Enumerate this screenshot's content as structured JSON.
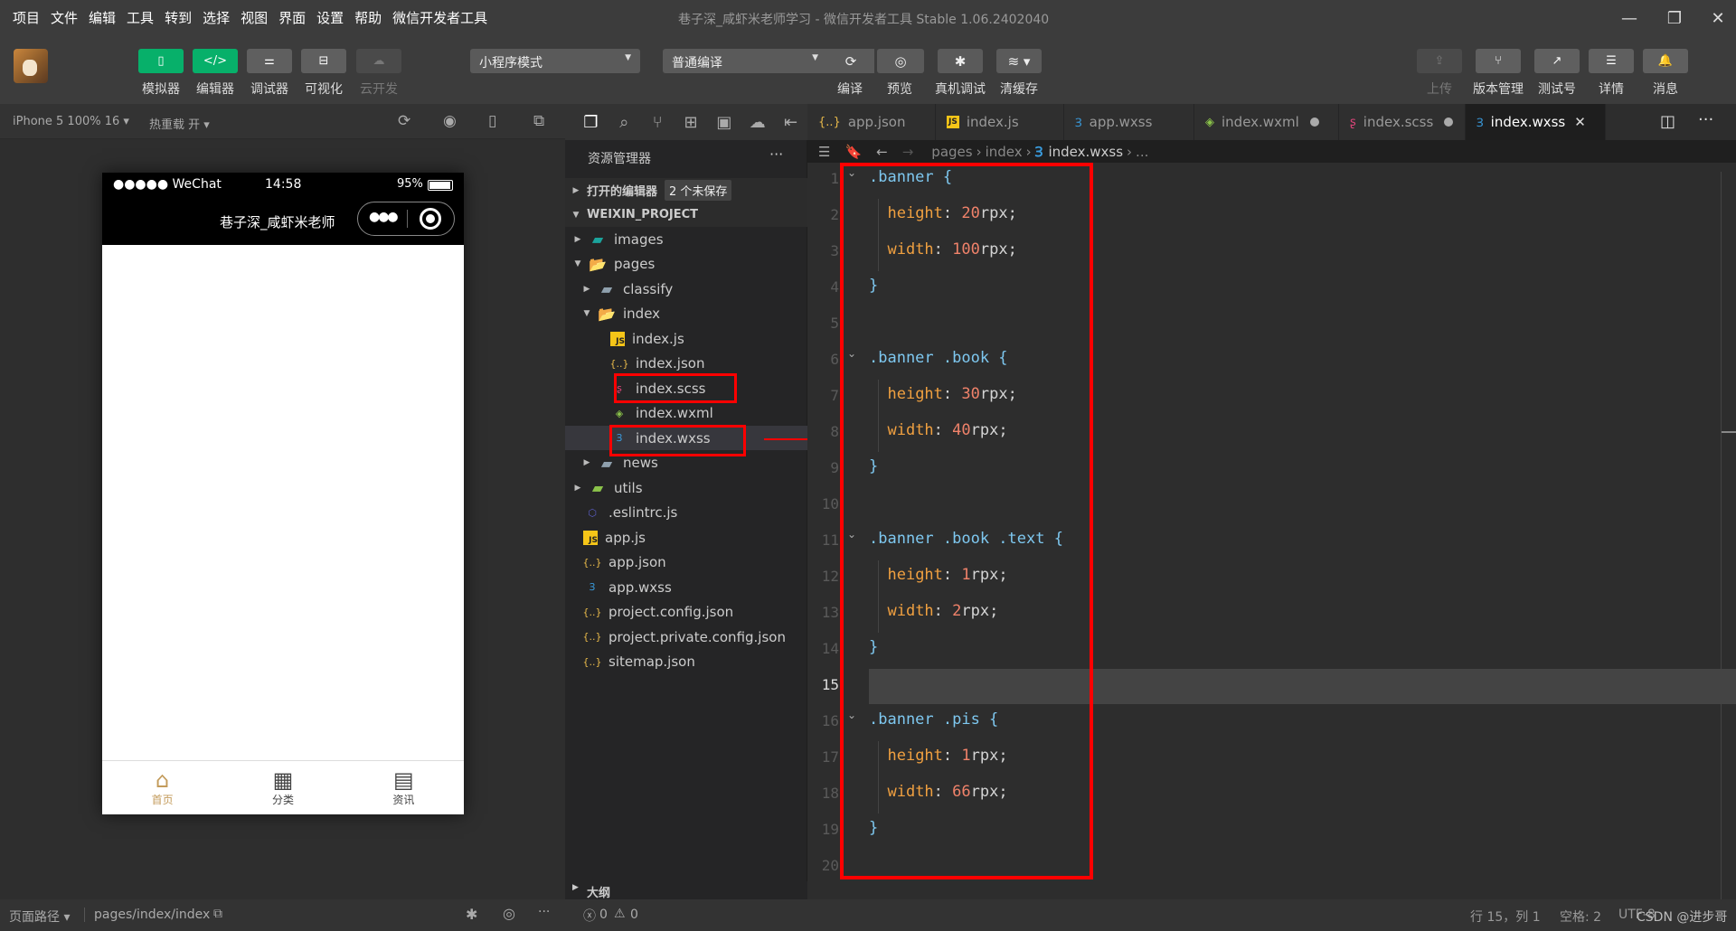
{
  "menu": [
    "项目",
    "文件",
    "编辑",
    "工具",
    "转到",
    "选择",
    "视图",
    "界面",
    "设置",
    "帮助",
    "微信开发者工具"
  ],
  "window_title": "巷子深_咸虾米老师学习 - 微信开发者工具 Stable 1.06.2402040",
  "toolbar": {
    "left_buttons": [
      {
        "label": "模拟器",
        "icon": "phone-icon",
        "state": "active"
      },
      {
        "label": "编辑器",
        "icon": "code-icon",
        "state": "active"
      },
      {
        "label": "调试器",
        "icon": "sliders-icon",
        "state": "normal"
      },
      {
        "label": "可视化",
        "icon": "layout-icon",
        "state": "normal"
      },
      {
        "label": "云开发",
        "icon": "cloud-icon",
        "state": "disabled"
      }
    ],
    "mode_select": "小程序模式",
    "compile_select": "普通编译",
    "mid_buttons": [
      {
        "label": "编译",
        "icon": "refresh-icon"
      },
      {
        "label": "预览",
        "icon": "eye-icon"
      },
      {
        "label": "真机调试",
        "icon": "bug-icon"
      },
      {
        "label": "清缓存",
        "icon": "layers-icon"
      }
    ],
    "right_buttons": [
      {
        "label": "上传",
        "icon": "upload-icon",
        "state": "disabled"
      },
      {
        "label": "版本管理",
        "icon": "branch-icon",
        "state": "normal"
      },
      {
        "label": "测试号",
        "icon": "external-link-icon",
        "state": "normal"
      },
      {
        "label": "详情",
        "icon": "menu-icon",
        "state": "normal"
      },
      {
        "label": "消息",
        "icon": "bell-icon",
        "state": "normal"
      }
    ]
  },
  "simulator": {
    "device": "iPhone 5 100% 16",
    "hot_reload": "热重载 开",
    "status": {
      "signal": "●●●●● WeChat",
      "time": "14:58",
      "battery": "95%"
    },
    "nav_title": "巷子深_咸虾米老师",
    "tabbar": [
      {
        "label": "首页",
        "active": true,
        "icon": "home-icon"
      },
      {
        "label": "分类",
        "active": false,
        "icon": "grid-icon"
      },
      {
        "label": "资讯",
        "active": false,
        "icon": "news-icon"
      }
    ],
    "page_path_label": "页面路径",
    "page_path": "pages/index/index"
  },
  "explorer": {
    "title": "资源管理器",
    "open_editors": "打开的编辑器",
    "unsaved_badge": "2 个未保存",
    "project": "WEIXIN_PROJECT",
    "tree": [
      {
        "name": "images",
        "type": "folder",
        "depth": 1,
        "expanded": false
      },
      {
        "name": "pages",
        "type": "folder",
        "depth": 1,
        "expanded": true
      },
      {
        "name": "classify",
        "type": "folder",
        "depth": 2,
        "expanded": false
      },
      {
        "name": "index",
        "type": "folder",
        "depth": 2,
        "expanded": true
      },
      {
        "name": "index.js",
        "type": "js",
        "depth": 3
      },
      {
        "name": "index.json",
        "type": "json",
        "depth": 3
      },
      {
        "name": "index.scss",
        "type": "scss",
        "depth": 3
      },
      {
        "name": "index.wxml",
        "type": "wxml",
        "depth": 3
      },
      {
        "name": "index.wxss",
        "type": "wxss",
        "depth": 3,
        "selected": true
      },
      {
        "name": "news",
        "type": "folder",
        "depth": 2,
        "expanded": false
      },
      {
        "name": "utils",
        "type": "folder",
        "depth": 1,
        "expanded": false
      },
      {
        "name": ".eslintrc.js",
        "type": "eslint",
        "depth": 1
      },
      {
        "name": "app.js",
        "type": "js",
        "depth": 1
      },
      {
        "name": "app.json",
        "type": "json",
        "depth": 1
      },
      {
        "name": "app.wxss",
        "type": "wxss",
        "depth": 1
      },
      {
        "name": "project.config.json",
        "type": "json",
        "depth": 1
      },
      {
        "name": "project.private.config.json",
        "type": "json",
        "depth": 1
      },
      {
        "name": "sitemap.json",
        "type": "json",
        "depth": 1
      }
    ],
    "outline": "大纲",
    "errors": "0",
    "warnings": "0"
  },
  "tabs": [
    {
      "name": "app.json",
      "type": "json",
      "dirty": false,
      "active": false
    },
    {
      "name": "index.js",
      "type": "js",
      "dirty": false,
      "active": false
    },
    {
      "name": "app.wxss",
      "type": "wxss",
      "dirty": false,
      "active": false
    },
    {
      "name": "index.wxml",
      "type": "wxml",
      "dirty": true,
      "active": false
    },
    {
      "name": "index.scss",
      "type": "scss",
      "dirty": true,
      "active": false
    },
    {
      "name": "index.wxss",
      "type": "wxss",
      "dirty": false,
      "active": true
    }
  ],
  "breadcrumb": [
    "pages",
    "index",
    "index.wxss",
    "..."
  ],
  "code": [
    ".banner {",
    "  height: 20rpx;",
    "  width: 100rpx;",
    "}",
    "",
    ".banner .book {",
    "  height: 30rpx;",
    "  width: 40rpx;",
    "}",
    "",
    ".banner .book .text {",
    "  height: 1rpx;",
    "  width: 2rpx;",
    "}",
    "",
    ".banner .pis {",
    "  height: 1rpx;",
    "  width: 66rpx;",
    "}",
    ""
  ],
  "current_line": 15,
  "statusbar": {
    "position": "行 15，列 1",
    "indent": "空格: 2",
    "encoding": "UTF-8",
    "watermark": "CSDN @进步哥"
  },
  "colors": {
    "accent_green": "#07b06a",
    "highlight_red": "#ff0000",
    "tab_active": "#c39b5b"
  }
}
